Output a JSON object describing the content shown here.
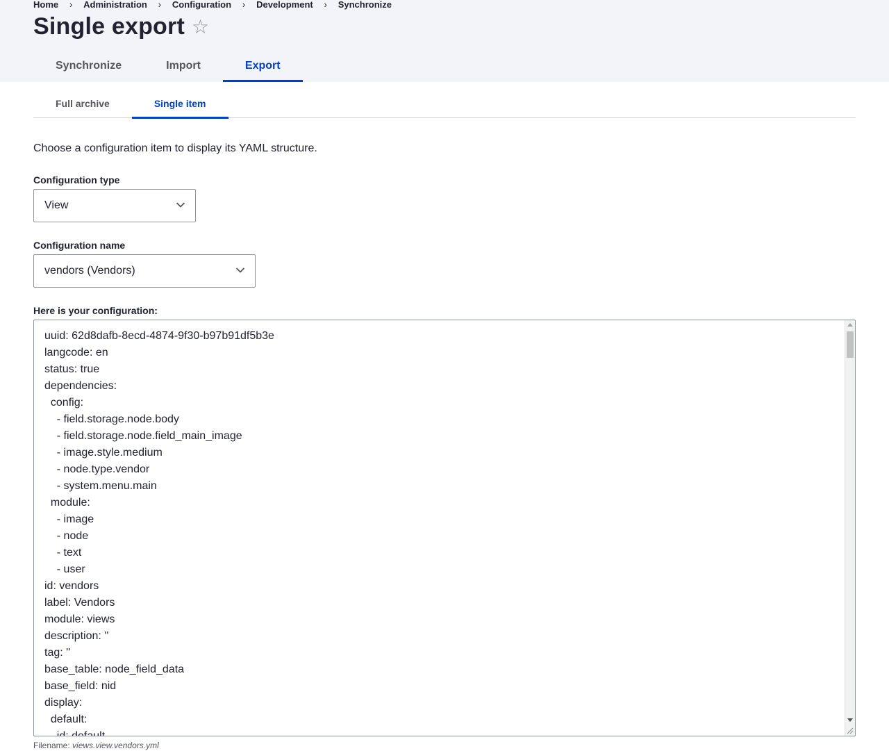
{
  "breadcrumb": {
    "items": [
      "Home",
      "Administration",
      "Configuration",
      "Development",
      "Synchronize"
    ],
    "separator": "›"
  },
  "page": {
    "title": "Single export",
    "favorite_icon": "star-outline-icon"
  },
  "primary_tabs": [
    {
      "label": "Synchronize",
      "active": false
    },
    {
      "label": "Import",
      "active": false
    },
    {
      "label": "Export",
      "active": true
    }
  ],
  "secondary_tabs": [
    {
      "label": "Full archive",
      "active": false
    },
    {
      "label": "Single item",
      "active": true
    }
  ],
  "form": {
    "description": "Choose a configuration item to display its YAML structure.",
    "config_type": {
      "label": "Configuration type",
      "value": "View"
    },
    "config_name": {
      "label": "Configuration name",
      "value": "vendors (Vendors)"
    },
    "output": {
      "label": "Here is your configuration:",
      "text": "uuid: 62d8dafb-8ecd-4874-9f30-b97b91df5b3e\nlangcode: en\nstatus: true\ndependencies:\n  config:\n    - field.storage.node.body\n    - field.storage.node.field_main_image\n    - image.style.medium\n    - node.type.vendor\n    - system.menu.main\n  module:\n    - image\n    - node\n    - text\n    - user\nid: vendors\nlabel: Vendors\nmodule: views\ndescription: ''\ntag: ''\nbase_table: node_field_data\nbase_field: nid\ndisplay:\n  default:\n    id: default"
    },
    "filename_label": "Filename:",
    "filename": "views.view.vendors.yml"
  },
  "colors": {
    "accent": "#003ecc",
    "header_bg": "#f3f4f9",
    "text": "#222330",
    "muted": "#55565b"
  }
}
